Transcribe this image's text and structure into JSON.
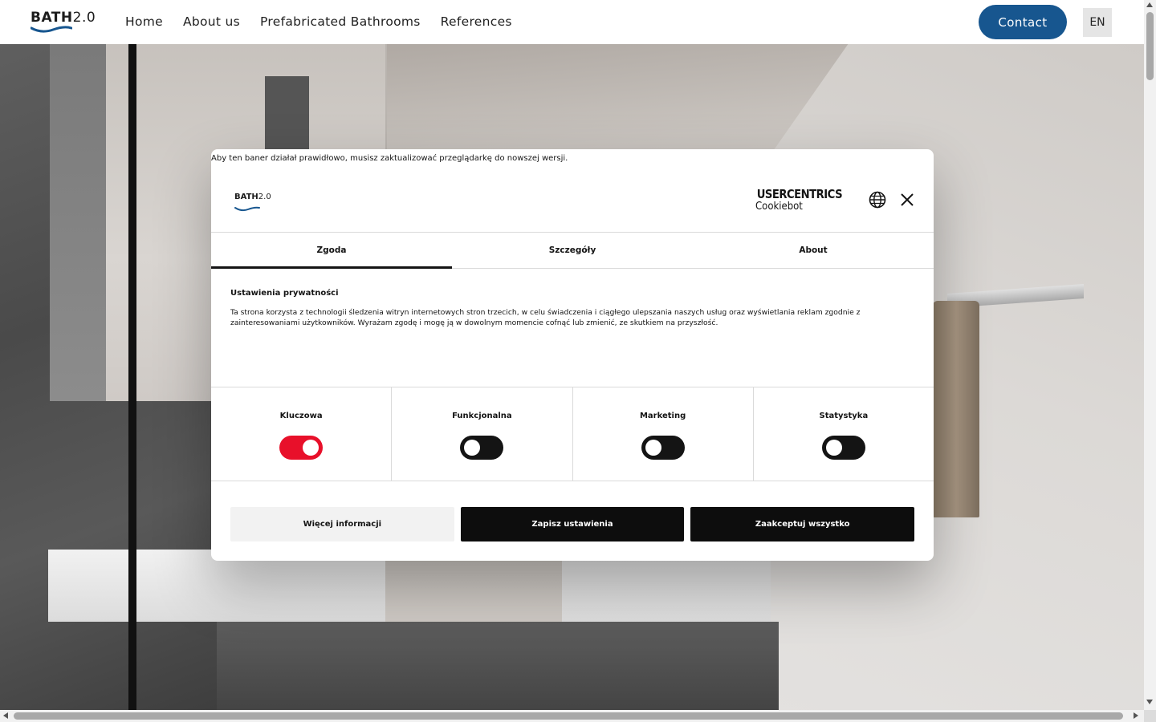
{
  "header": {
    "logo_bold": "BATH",
    "logo_light": "2.0",
    "nav": [
      "Home",
      "About us",
      "Prefabricated Bathrooms",
      "References"
    ],
    "contact_label": "Contact",
    "lang_label": "EN",
    "accent_color": "#17568f"
  },
  "dialog": {
    "browser_warning": "Aby ten baner działał prawidłowo, musisz zaktualizować przeglądarkę do nowszej wersji.",
    "logo_bold": "BATH",
    "logo_light": "2.0",
    "brand_top": "USERCENTRICS",
    "brand_bottom": "Cookiebot",
    "globe_icon": "globe-icon",
    "close_icon": "close-icon",
    "tabs": [
      {
        "label": "Zgoda",
        "active": true
      },
      {
        "label": "Szczegóły",
        "active": false
      },
      {
        "label": "About",
        "active": false
      }
    ],
    "title": "Ustawienia prywatności",
    "body": "Ta strona korzysta z technologii śledzenia witryn internetowych stron trzecich, w celu świadczenia i ciągłego ulepszania naszych usług oraz wyświetlania reklam zgodnie z zainteresowaniami użytkowników. Wyrażam zgodę i mogę ją w dowolnym momencie cofnąć lub zmienić, ze skutkiem na przyszłość.",
    "toggles": [
      {
        "label": "Kluczowa",
        "on": true
      },
      {
        "label": "Funkcjonalna",
        "on": false
      },
      {
        "label": "Marketing",
        "on": false
      },
      {
        "label": "Statystyka",
        "on": false
      }
    ],
    "buttons": {
      "more_info": "Więcej informacji",
      "save": "Zapisz ustawienia",
      "accept_all": "Zaakceptuj wszystko"
    },
    "toggle_on_color": "#e8102a"
  }
}
